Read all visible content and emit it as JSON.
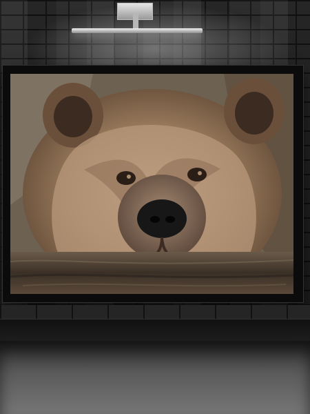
{
  "scene": {
    "description_label": "",
    "colors": {
      "wall": "#2b2b2b",
      "frame": "#0b0b0b",
      "floor": "#5b5b5b",
      "fur": "#8f7458"
    }
  },
  "icons": {
    "lamp": "picture-light",
    "bear": "bear-photo"
  }
}
